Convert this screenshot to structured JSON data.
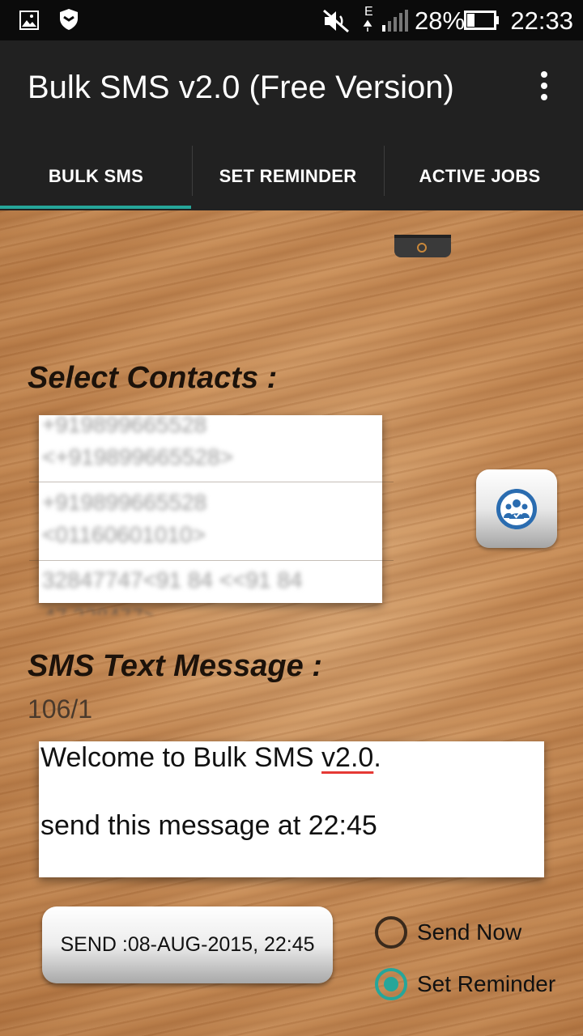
{
  "status_bar": {
    "battery": "28%",
    "time": "22:33",
    "network": "E",
    "icons": [
      "gallery-icon",
      "shield-icon",
      "mute-icon",
      "signal-icon",
      "battery-icon"
    ]
  },
  "app_bar": {
    "title": "Bulk SMS v2.0 (Free Version)",
    "overflow_icon": "more-vert-icon"
  },
  "tabs": [
    {
      "label": "BULK SMS",
      "active": true
    },
    {
      "label": "SET REMINDER",
      "active": false
    },
    {
      "label": "ACTIVE JOBS",
      "active": false
    }
  ],
  "contacts": {
    "title": "Select Contacts  :",
    "entries": [
      "+919899665528",
      "<+919899665528>",
      "+919899665528",
      "<01160601010>",
      "32847747<91 84 <<91 84",
      "47 328477>"
    ],
    "picker_icon": "contacts-group-icon"
  },
  "message": {
    "title": "SMS Text Message :",
    "counter": "106/1",
    "line1_prefix": "Welcome to Bulk SMS ",
    "line1_spellchecked": "v2.0",
    "line1_suffix": ".",
    "line2": "send this message at 22:45"
  },
  "send_button": {
    "label": "SEND :08-AUG-2015, 22:45"
  },
  "mode_options": [
    {
      "label": "Send Now",
      "selected": false
    },
    {
      "label": "Set Reminder",
      "selected": true
    }
  ],
  "colors": {
    "accent": "#26a69a",
    "toolbar": "#212121",
    "status_bar": "#0b0b0b"
  }
}
